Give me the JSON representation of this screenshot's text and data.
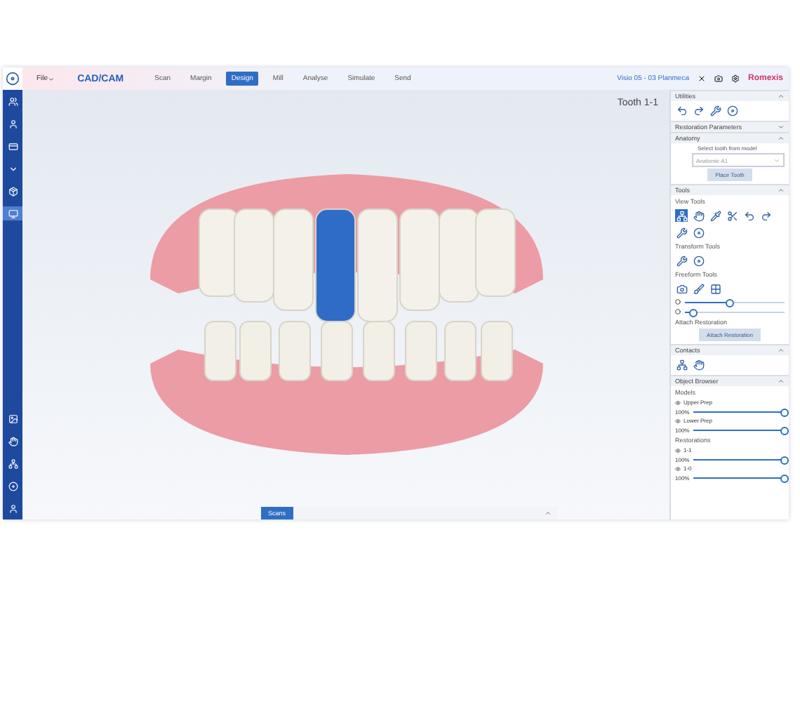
{
  "menu": {
    "label": "File"
  },
  "app_title": "CAD/CAM",
  "tabs": [
    {
      "label": "Scan",
      "selected": false
    },
    {
      "label": "Margin",
      "selected": false
    },
    {
      "label": "Design",
      "selected": true
    },
    {
      "label": "Mill",
      "selected": false
    },
    {
      "label": "Analyse",
      "selected": false
    },
    {
      "label": "Simulate",
      "selected": false
    },
    {
      "label": "Send",
      "selected": false
    }
  ],
  "header_right": {
    "device": "Visio 05 - 03 Planmeca",
    "brand": "Romexis"
  },
  "sidebar": {
    "top": [
      {
        "selected": false
      },
      {
        "selected": false
      },
      {
        "selected": false
      },
      {
        "selected": false
      },
      {
        "selected": false
      },
      {
        "selected": true
      }
    ],
    "bottom": [
      {
        "selected": false
      },
      {
        "selected": false
      },
      {
        "selected": false
      },
      {
        "selected": false
      },
      {
        "selected": false
      }
    ]
  },
  "viewport": {
    "label": "Tooth 1-1"
  },
  "bottom_bar": {
    "tab": "Scans",
    "expanded": false
  },
  "panel": [
    {
      "title": "Utilities",
      "expanded": true,
      "items": [
        {
          "kind": "icons",
          "icons": [
            {
              "selected": false
            },
            {
              "selected": false
            },
            {
              "selected": false
            },
            {
              "selected": false
            }
          ]
        }
      ]
    },
    {
      "title": "Restoration Parameters",
      "expanded": false
    },
    {
      "title": "Anatomy",
      "expanded": true,
      "items": [
        {
          "kind": "hint",
          "text": "Select tooth from model"
        },
        {
          "kind": "select",
          "value": "Anatomic A1"
        },
        {
          "kind": "button",
          "label": "Place Tooth",
          "disabled": true
        }
      ]
    },
    {
      "title": "Tools",
      "expanded": true,
      "items": [
        {
          "kind": "subheading",
          "text": "View Tools"
        },
        {
          "kind": "icons",
          "icons": [
            {
              "selected": true
            },
            {
              "selected": false
            },
            {
              "selected": false
            },
            {
              "selected": false
            },
            {
              "selected": false
            },
            {
              "selected": false
            },
            {
              "selected": false
            },
            {
              "selected": false
            }
          ]
        },
        {
          "kind": "subheading",
          "text": "Transform Tools"
        },
        {
          "kind": "icons",
          "icons": [
            {
              "selected": false
            },
            {
              "selected": false
            }
          ]
        },
        {
          "kind": "subheading",
          "text": "Freeform Tools"
        },
        {
          "kind": "icons",
          "icons": [
            {
              "selected": false
            },
            {
              "selected": false
            },
            {
              "selected": false
            }
          ]
        },
        {
          "kind": "slider",
          "level": 0.45
        },
        {
          "kind": "slider",
          "level": 0.08
        },
        {
          "kind": "subheading",
          "text": "Attach Restoration"
        },
        {
          "kind": "button",
          "label": "Attach Restoration",
          "disabled": true
        }
      ]
    },
    {
      "title": "Contacts",
      "expanded": true,
      "items": [
        {
          "kind": "icons",
          "icons": [
            {
              "selected": false
            },
            {
              "selected": false
            }
          ]
        }
      ]
    },
    {
      "title": "Object Browser",
      "expanded": true,
      "items": [
        {
          "kind": "subheading",
          "text": "Models"
        },
        {
          "kind": "object",
          "name": "Upper Prep",
          "reading": "100%",
          "level": 1
        },
        {
          "kind": "object",
          "name": "Lower Prep",
          "reading": "100%",
          "level": 1
        },
        {
          "kind": "subheading",
          "text": "Restorations"
        },
        {
          "kind": "object",
          "name": "1-1",
          "reading": "100%",
          "level": 1
        },
        {
          "kind": "object",
          "name": "1-0",
          "reading": "100%",
          "level": 1
        }
      ]
    }
  ]
}
